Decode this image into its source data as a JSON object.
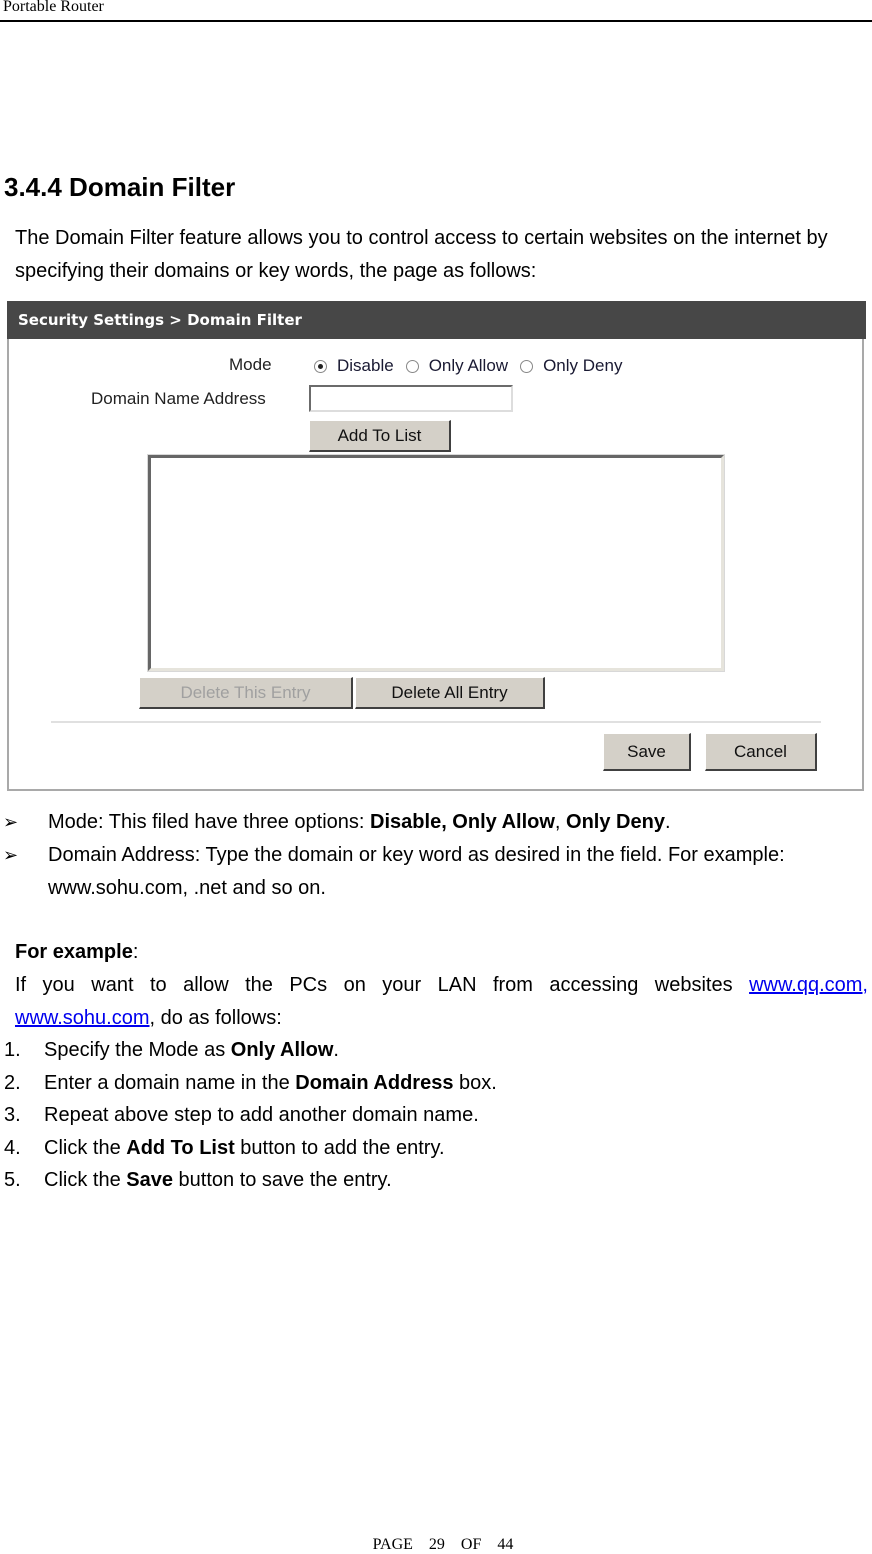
{
  "running_header": "Portable Router",
  "section": {
    "title": "3.4.4 Domain Filter",
    "intro": "The Domain Filter feature allows you to control access to certain websites on the internet by specifying their domains or key words, the page as follows:"
  },
  "ui": {
    "breadcrumb": "Security Settings > Domain Filter",
    "mode_label": "Mode",
    "mode_options": [
      {
        "label": "Disable",
        "checked": true
      },
      {
        "label": "Only Allow",
        "checked": false
      },
      {
        "label": "Only Deny",
        "checked": false
      }
    ],
    "domain_label": "Domain Name Address",
    "domain_value": "",
    "add_button": "Add To List",
    "entries": [],
    "delete_this_button": "Delete This Entry",
    "delete_this_disabled": true,
    "delete_all_button": "Delete All Entry",
    "save_button": "Save",
    "cancel_button": "Cancel",
    "colors": {
      "header_bg": "#474747",
      "button_bg": "#d4d0c8"
    }
  },
  "bullets": [
    {
      "icon": "arrowhead-bullet-icon",
      "prefix": "Mode: This filed have three options: ",
      "bold1": "Disable, Only Allow",
      "mid": ", ",
      "bold2": "Only Deny",
      "suffix": "."
    },
    {
      "icon": "arrowhead-bullet-icon",
      "text": "Domain Address: Type the domain or key word as desired in the field. For example: www.sohu.com, .net and so on."
    }
  ],
  "example": {
    "heading": "For example",
    "heading_suffix": ":",
    "line_prefix": "If you want to allow the PCs on your LAN from accessing websites ",
    "link1": "www.qq.com,",
    "link2": "www.sohu.com",
    "line_suffix": ", do as follows:"
  },
  "steps": [
    {
      "num": "1.",
      "pre": "Specify the Mode as ",
      "bold": "Only Allow",
      "post": "."
    },
    {
      "num": "2.",
      "pre": "Enter a domain name in the ",
      "bold": "Domain Address",
      "post": " box."
    },
    {
      "num": "3.",
      "pre": "Repeat above step to add another domain name.",
      "bold": "",
      "post": ""
    },
    {
      "num": "4.",
      "pre": "Click the ",
      "bold": "Add To List",
      "post": " button to add the entry."
    },
    {
      "num": "5.",
      "pre": "Click the ",
      "bold": "Save",
      "post": " button to save the entry."
    }
  ],
  "footer": {
    "page_label": "PAGE",
    "page_num": "29",
    "of_label": "OF",
    "total": "44"
  }
}
